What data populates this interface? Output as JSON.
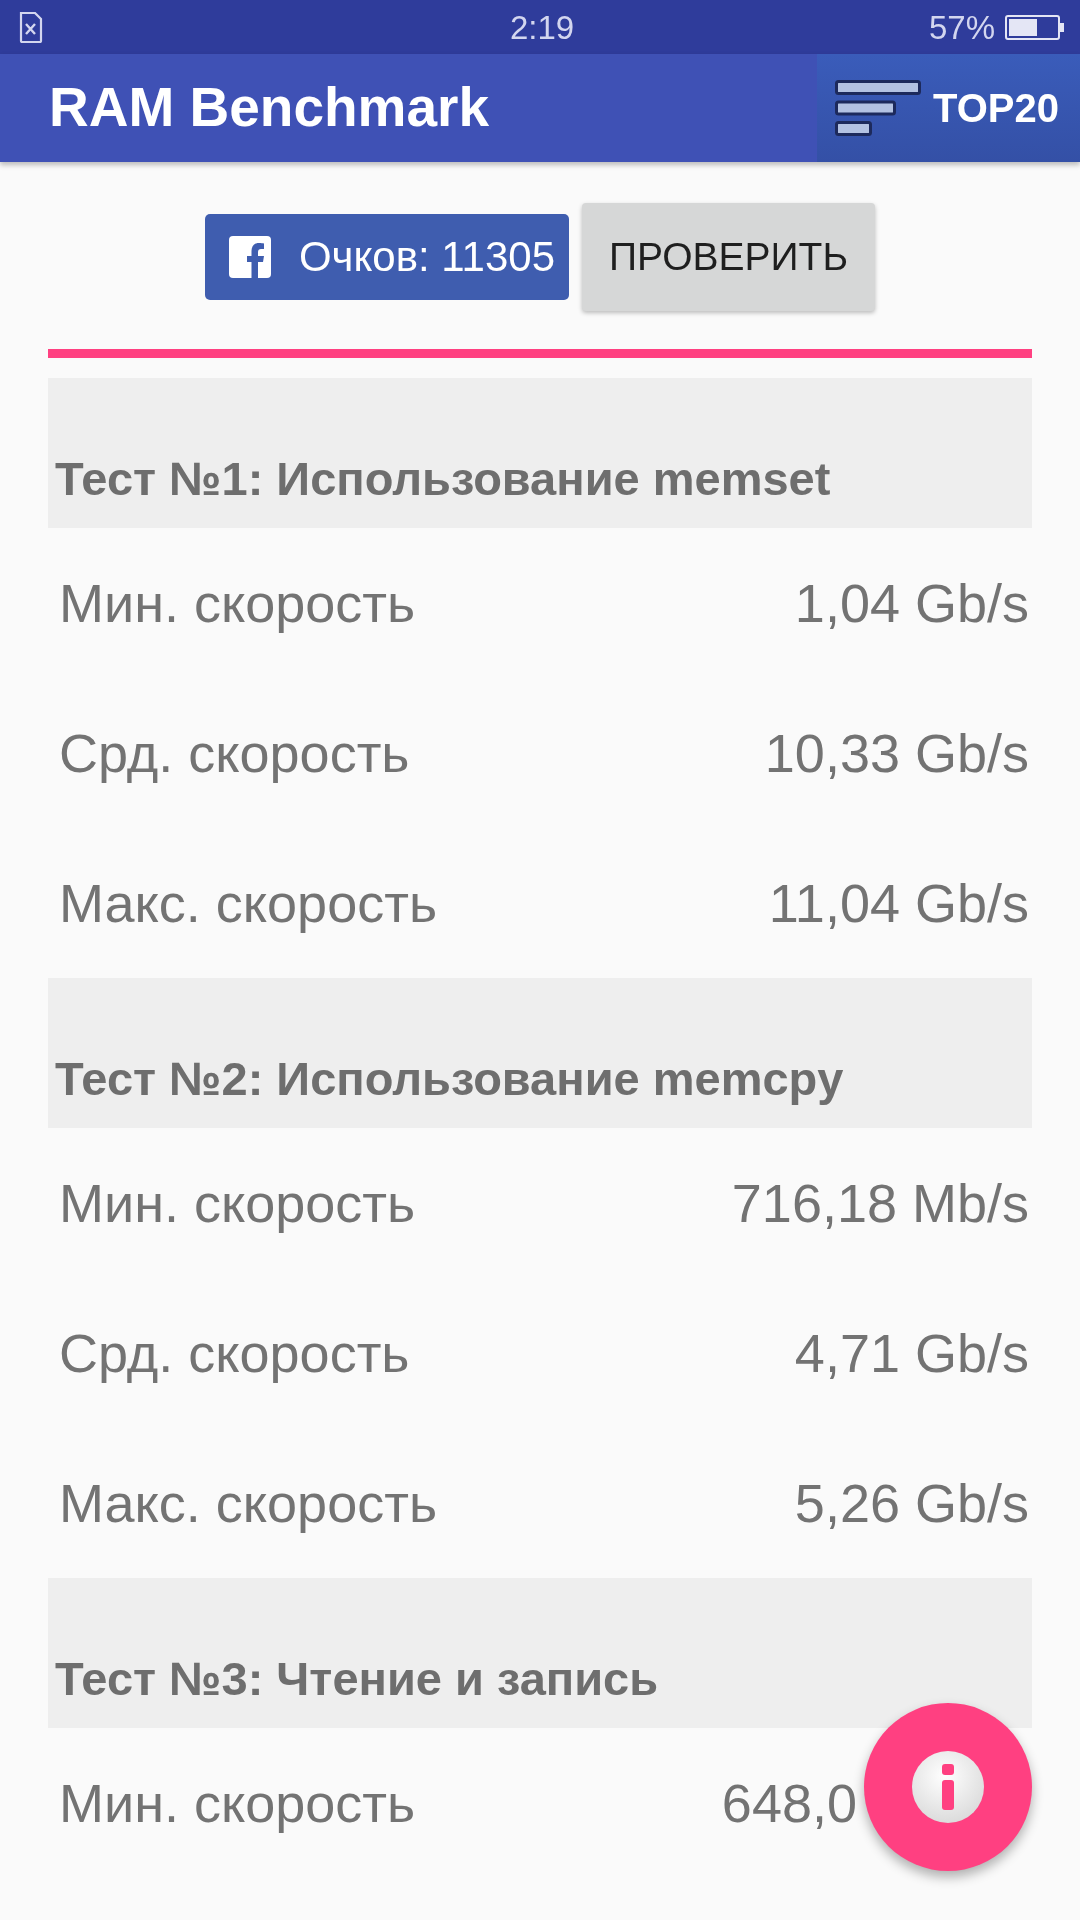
{
  "status_bar": {
    "time": "2:19",
    "battery": "57%"
  },
  "app_bar": {
    "title": "RAM Benchmark",
    "top_button": "TOP20"
  },
  "actions": {
    "score_button": "Очков: 11305",
    "check_button": "ПРОВЕРИТЬ"
  },
  "tests": [
    {
      "title": "Тест №1: Использование memset",
      "rows": [
        {
          "label": "Мин. скорость",
          "value": "1,04 Gb/s"
        },
        {
          "label": "Срд. скорость",
          "value": "10,33 Gb/s"
        },
        {
          "label": "Макс. скорость",
          "value": "11,04 Gb/s"
        }
      ]
    },
    {
      "title": "Тест №2: Использование memcpy",
      "rows": [
        {
          "label": "Мин. скорость",
          "value": "716,18 Mb/s"
        },
        {
          "label": "Срд. скорость",
          "value": "4,71 Gb/s"
        },
        {
          "label": "Макс. скорость",
          "value": "5,26 Gb/s"
        }
      ]
    },
    {
      "title": "Тест №3: Чтение и запись",
      "rows": [
        {
          "label": "Мин. скорость",
          "value": "648,0"
        }
      ]
    }
  ]
}
